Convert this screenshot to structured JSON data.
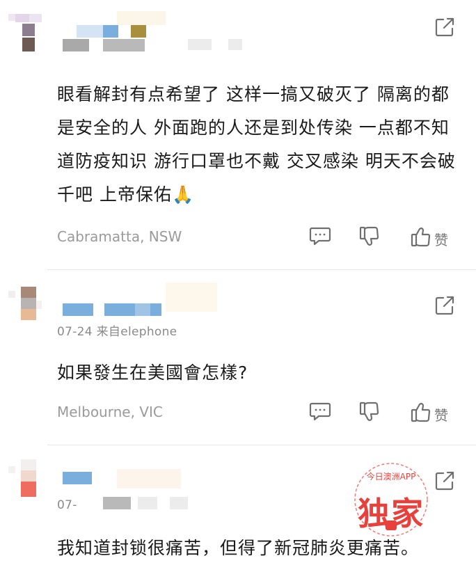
{
  "comments": [
    {
      "meta": "",
      "text": "眼看解封有点希望了 这样一搞又破灭了 隔离的都是安全的人 外面跑的人还是到处传染 一点都不知道防疫知识 游行口罩也不戴 交叉感染 明天不会破千吧 上帝保佑🙏",
      "location": "Cabramatta, NSW",
      "like_label": "赞"
    },
    {
      "meta": "07-24  来自elephone",
      "text": "如果發生在美國會怎樣?",
      "location": "Melbourne, VIC",
      "like_label": "赞"
    },
    {
      "meta": "07-",
      "text": "我知道封锁很痛苦，但得了新冠肺炎更痛苦。",
      "location": "",
      "like_label": ""
    }
  ],
  "watermark": {
    "arc_text": "今日澳洲APP",
    "main_text": "独家"
  },
  "colors": {
    "accent_red": "#e8413c",
    "icon_gray": "#6f6f6f",
    "meta_gray": "#8a8a8a"
  },
  "icons": {
    "share": "share-out-icon",
    "reply": "comment-bubble-icon",
    "dislike": "thumbs-down-icon",
    "like": "thumbs-up-icon"
  }
}
